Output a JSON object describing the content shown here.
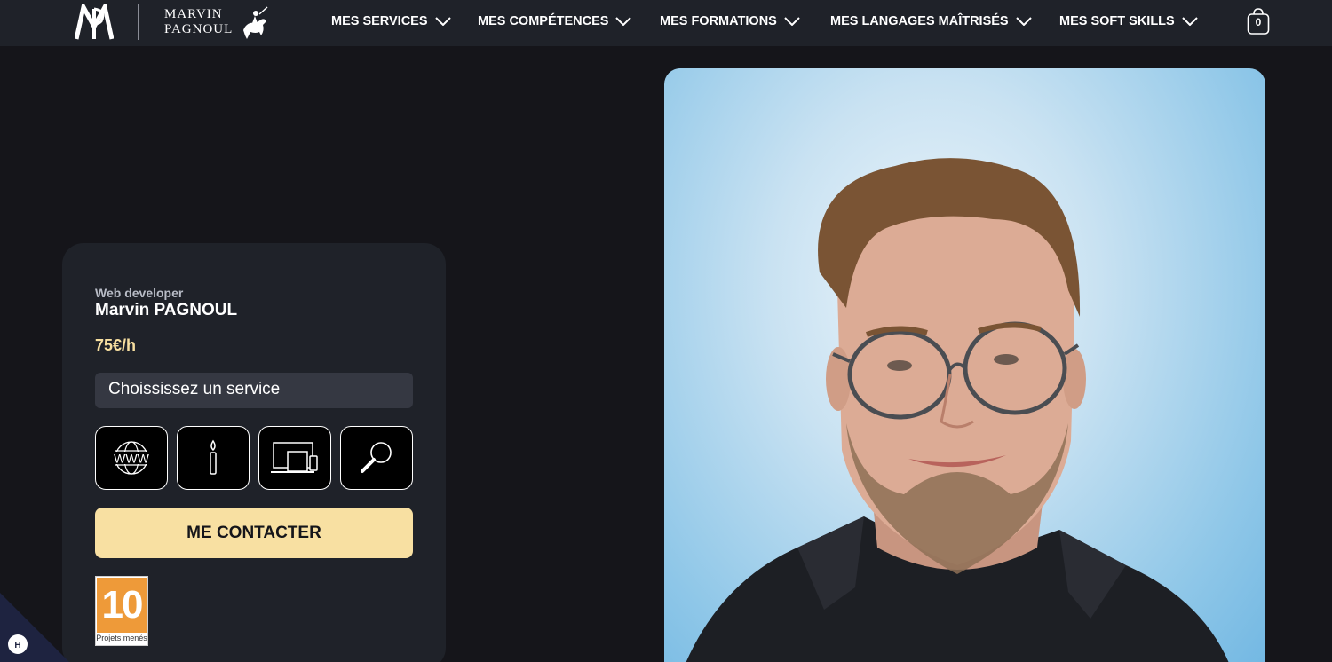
{
  "header": {
    "logo_monogram": "MP",
    "logo_name_line1": "MARVIN",
    "logo_name_line2": "PAGNOUL",
    "nav": [
      {
        "label": "MES SERVICES"
      },
      {
        "label": "MES COMPÉTENCES"
      },
      {
        "label": "MES FORMATIONS"
      },
      {
        "label": "MES LANGAGES MAÎTRISÉS"
      },
      {
        "label": "MES SOFT SKILLS"
      }
    ],
    "cart_count": "0"
  },
  "profile": {
    "role": "Web developer",
    "name": "Marvin PAGNOUL",
    "price": "75€/h",
    "service_select": "Choississez un service",
    "service_icons": [
      "www-globe-icon",
      "brush-icon",
      "devices-icon",
      "magnifier-icon"
    ],
    "contact_label": "ME CONTACTER",
    "badge_number": "10",
    "badge_label": "Projets menés"
  },
  "photo": {
    "subject": "portrait"
  },
  "colors": {
    "background": "#15151a",
    "header_bg": "#1f2229",
    "card_bg": "#1f2229",
    "accent": "#f8e0a2",
    "badge_orange": "#ee9a39"
  }
}
